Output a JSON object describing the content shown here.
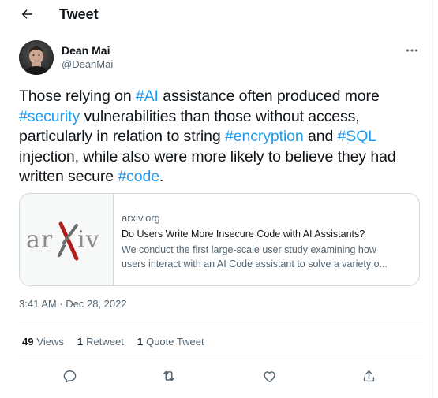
{
  "header": {
    "title": "Tweet",
    "back_icon": "arrow-left-icon"
  },
  "author": {
    "name": "Dean Mai",
    "handle": "@DeanMai",
    "more_icon": "more-horizontal-icon"
  },
  "tweet": {
    "segments": [
      {
        "text": "Those relying on ",
        "hashtag": false
      },
      {
        "text": "#AI",
        "hashtag": true
      },
      {
        "text": " assistance often produced more ",
        "hashtag": false
      },
      {
        "text": "#security",
        "hashtag": true
      },
      {
        "text": " vulnerabilities than those without access, particularly in relation to string ",
        "hashtag": false
      },
      {
        "text": "#encryption",
        "hashtag": true
      },
      {
        "text": " and ",
        "hashtag": false
      },
      {
        "text": "#SQL",
        "hashtag": true
      },
      {
        "text": " injection, while also were more likely to believe they had written secure ",
        "hashtag": false
      },
      {
        "text": "#code",
        "hashtag": true
      },
      {
        "text": ".",
        "hashtag": false
      }
    ]
  },
  "card": {
    "logo_text": "arXiv",
    "domain": "arxiv.org",
    "title": "Do Users Write More Insecure Code with AI Assistants?",
    "description_lines": [
      "We conduct the first large-scale user study examining how",
      "users interact with an AI Code assistant to solve a variety o..."
    ]
  },
  "timestamp": "3:41 AM · Dec 28, 2022",
  "stats": {
    "views": {
      "count": "49",
      "label": "Views"
    },
    "retweets": {
      "count": "1",
      "label": "Retweet"
    },
    "quotes": {
      "count": "1",
      "label": "Quote Tweet"
    }
  },
  "actions": [
    "reply-icon",
    "retweet-icon",
    "like-icon",
    "share-icon"
  ],
  "colors": {
    "accent": "#1d9bf0",
    "text": "#0f1419",
    "secondary": "#536471",
    "border": "#cfd9de",
    "arxiv_red": "#b31b1b"
  }
}
